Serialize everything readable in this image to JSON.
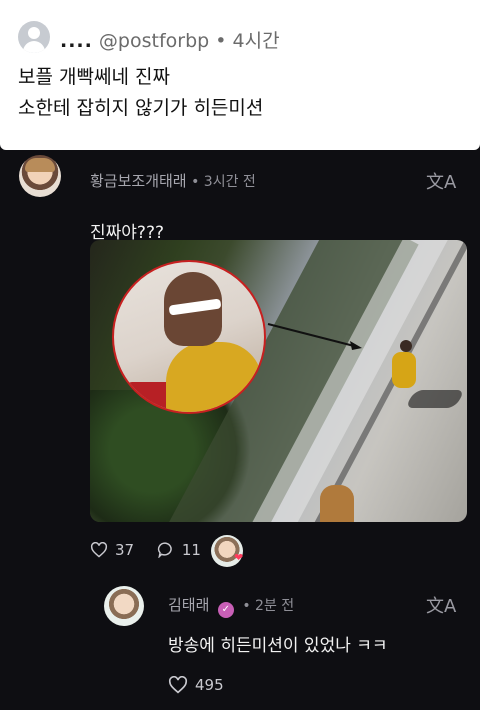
{
  "top_post": {
    "author_hidden": "....",
    "handle": "@postforbp",
    "separator": "•",
    "time": "4시간",
    "lines": [
      "보플 개빡쎄네 진짜",
      "소한테 잡히지 않기가 히든미션"
    ]
  },
  "comment": {
    "author": "황금보조개태래",
    "separator": "•",
    "time": "3시간 전",
    "text": "진짜야???",
    "likes": "37",
    "replies": "11",
    "translate_icon": "translate-icon"
  },
  "reply": {
    "author": "김태래",
    "verified_icon": "verified-badge-icon",
    "badge_glyph": "✓",
    "separator": "•",
    "time": "2분 전",
    "text": "방송에 히든미션이 있었나 ㅋㅋ",
    "likes": "495",
    "translate_icon": "translate-icon"
  },
  "icons": {
    "translate_glyph": "文A",
    "heart_glyph": "❤"
  },
  "colors": {
    "background": "#0e0e12",
    "top_post_bg": "#ffffff",
    "highlight_circle": "#c72020",
    "verified_badge": "#c85fb6"
  }
}
